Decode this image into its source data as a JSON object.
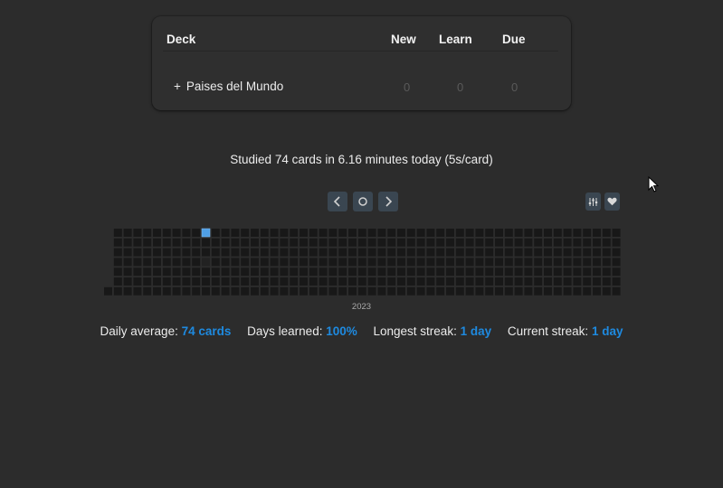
{
  "deck_table": {
    "headers": {
      "deck": "Deck",
      "new": "New",
      "learn": "Learn",
      "due": "Due"
    },
    "rows": [
      {
        "expand": "+",
        "name": "Paises del Mundo",
        "new": "0",
        "learn": "0",
        "due": "0"
      }
    ]
  },
  "studied_text": "Studied 74 cards in 6.16 minutes today (5s/card)",
  "heatmap": {
    "year_label": "2023",
    "weeks": 53,
    "days_per_week": 7,
    "studied_cell": {
      "week": 10,
      "day": 0
    },
    "colors": {
      "empty": "#181818",
      "studied": "#4f9fe6",
      "blank": "#222222"
    }
  },
  "stats": {
    "daily_average_label": "Daily average:",
    "daily_average_value": "74 cards",
    "days_learned_label": "Days learned:",
    "days_learned_value": "100%",
    "longest_streak_label": "Longest streak:",
    "longest_streak_value": "1 day",
    "current_streak_label": "Current streak:",
    "current_streak_value": "1 day"
  },
  "icons": {
    "prev": "chevron-left-icon",
    "today": "circle-icon",
    "next": "chevron-right-icon",
    "filter": "sliders-icon",
    "heart": "heart-icon"
  },
  "accent_color": "#1e8ae0"
}
